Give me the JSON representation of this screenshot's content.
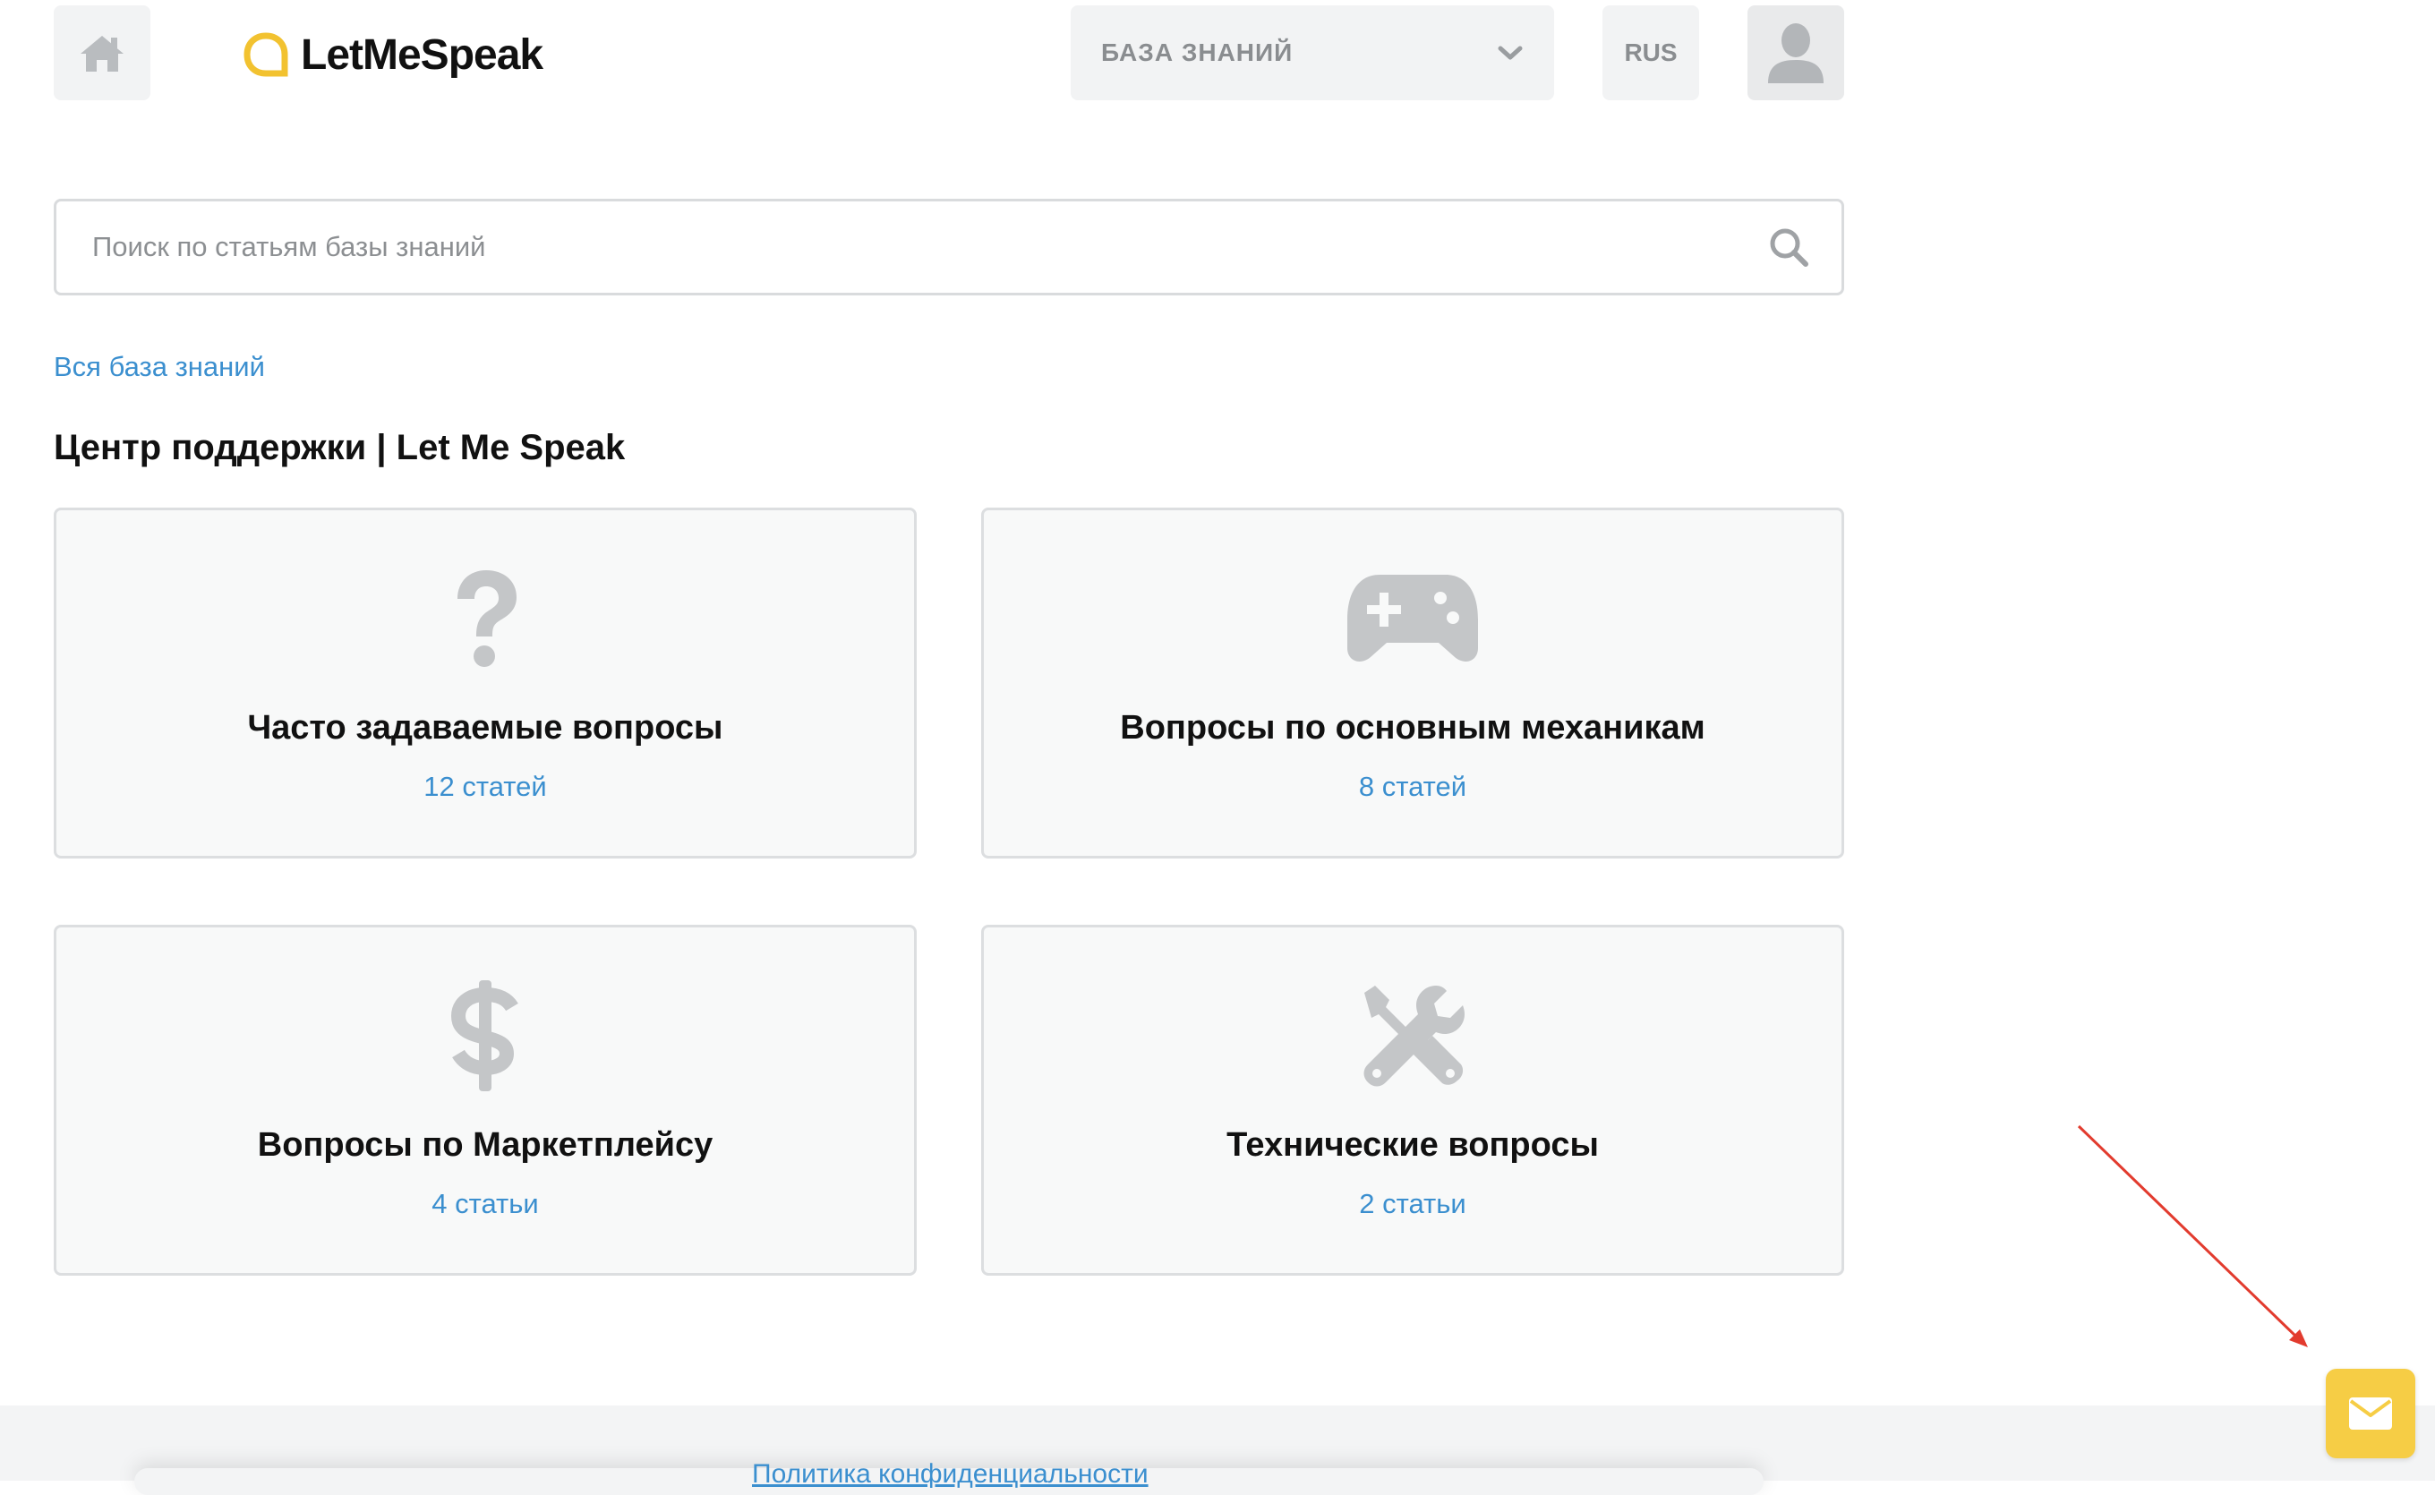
{
  "header": {
    "logo_text": "LetMeSpeak",
    "kb_select_label": "БАЗА ЗНАНИЙ",
    "lang_label": "RUS"
  },
  "search": {
    "placeholder": "Поиск по статьям базы знаний",
    "value": ""
  },
  "breadcrumb": "Вся база знаний",
  "page_title": "Центр поддержки | Let Me Speak",
  "categories": [
    {
      "icon": "question-icon",
      "title": "Часто задаваемые вопросы",
      "count": "12 статей"
    },
    {
      "icon": "gamepad-icon",
      "title": "Вопросы по основным механикам",
      "count": "8 статей"
    },
    {
      "icon": "dollar-icon",
      "title": "Вопросы по Маркетплейсу",
      "count": "4 статьи"
    },
    {
      "icon": "tools-icon",
      "title": "Технические вопросы",
      "count": "2 статьи"
    }
  ],
  "footer": {
    "link_text": "Политика конфиденциальности"
  },
  "colors": {
    "accent_link": "#3b8fcf",
    "logo_yellow": "#f2c230",
    "contact_button": "#f6cd45",
    "annotation_arrow": "#e23b2e",
    "icon_gray": "#c4c6c8"
  }
}
